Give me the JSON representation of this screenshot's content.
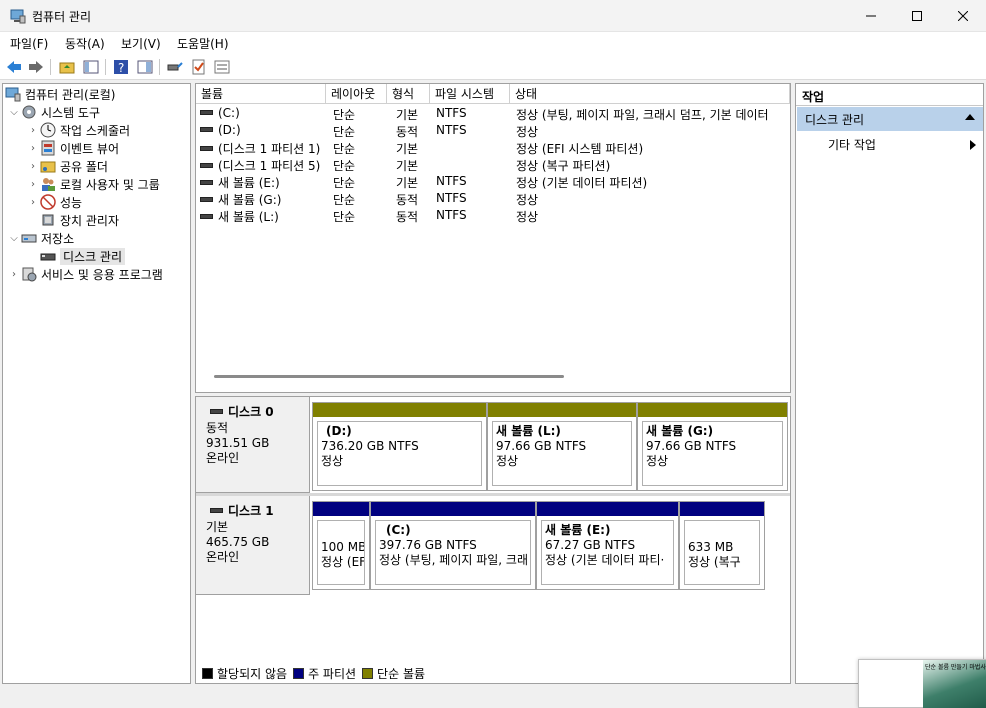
{
  "window": {
    "title": "컴퓨터 관리"
  },
  "menu": [
    "파일(F)",
    "동작(A)",
    "보기(V)",
    "도움말(H)"
  ],
  "tree": {
    "root": "컴퓨터 관리(로컬)",
    "system_tools": "시스템 도구",
    "task_scheduler": "작업 스케줄러",
    "event_viewer": "이벤트 뷰어",
    "shared_folders": "공유 폴더",
    "local_users": "로컬 사용자 및 그룹",
    "performance": "성능",
    "device_manager": "장치 관리자",
    "storage": "저장소",
    "disk_management": "디스크 관리",
    "services": "서비스 및 응용 프로그램"
  },
  "volume_table": {
    "columns": [
      "볼륨",
      "레이아웃",
      "형식",
      "파일 시스템",
      "상태"
    ],
    "rows": [
      {
        "volume": "(C:)",
        "layout": "단순",
        "type": "기본",
        "fs": "NTFS",
        "status": "정상 (부팅, 페이지 파일, 크래시 덤프, 기본 데이터"
      },
      {
        "volume": "(D:)",
        "layout": "단순",
        "type": "동적",
        "fs": "NTFS",
        "status": "정상"
      },
      {
        "volume": "(디스크 1 파티션 1)",
        "layout": "단순",
        "type": "기본",
        "fs": "",
        "status": "정상 (EFI 시스템 파티션)"
      },
      {
        "volume": "(디스크 1 파티션 5)",
        "layout": "단순",
        "type": "기본",
        "fs": "",
        "status": "정상 (복구 파티션)"
      },
      {
        "volume": "새 볼륨 (E:)",
        "layout": "단순",
        "type": "기본",
        "fs": "NTFS",
        "status": "정상 (기본 데이터 파티션)"
      },
      {
        "volume": "새 볼륨 (G:)",
        "layout": "단순",
        "type": "동적",
        "fs": "NTFS",
        "status": "정상"
      },
      {
        "volume": "새 볼륨 (L:)",
        "layout": "단순",
        "type": "동적",
        "fs": "NTFS",
        "status": "정상"
      }
    ]
  },
  "disks": [
    {
      "name": "디스크 0",
      "kind": "동적",
      "size": "931.51 GB",
      "state": "온라인",
      "partitions": [
        {
          "name": "(D:)",
          "size": "736.20 GB NTFS",
          "status": "정상",
          "color": "#808000"
        },
        {
          "name": "새 볼륨  (L:)",
          "size": "97.66 GB NTFS",
          "status": "정상",
          "color": "#808000"
        },
        {
          "name": "새 볼륨  (G:)",
          "size": "97.66 GB NTFS",
          "status": "정상",
          "color": "#808000"
        }
      ]
    },
    {
      "name": "디스크 1",
      "kind": "기본",
      "size": "465.75 GB",
      "state": "온라인",
      "partitions": [
        {
          "name": "",
          "size": "100 MB",
          "status": "정상 (EFI",
          "color": "#000080"
        },
        {
          "name": "(C:)",
          "size": "397.76 GB NTFS",
          "status": "정상 (부팅, 페이지 파일, 크래",
          "color": "#000080"
        },
        {
          "name": "새 볼륨  (E:)",
          "size": "67.27 GB NTFS",
          "status": "정상 (기본 데이터 파티·",
          "color": "#000080"
        },
        {
          "name": "",
          "size": "633 MB",
          "status": "정상 (복구 ",
          "color": "#000080"
        }
      ]
    }
  ],
  "legend": [
    {
      "label": "할당되지 않음",
      "color": "#000000"
    },
    {
      "label": "주 파티션",
      "color": "#000080"
    },
    {
      "label": "단순 볼륨",
      "color": "#808000"
    }
  ],
  "actions": {
    "title": "작업",
    "section": "디스크 관리",
    "more": "기타 작업"
  },
  "notification": {
    "thumb_text": "단순 볼륨 만들기 마법사"
  }
}
